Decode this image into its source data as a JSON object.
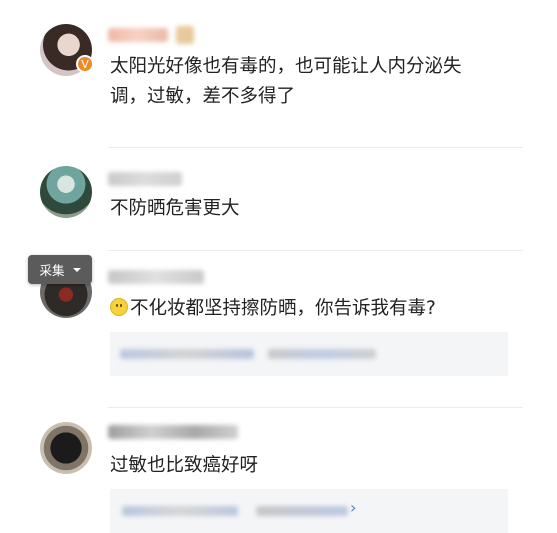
{
  "comments": [
    {
      "text_line1": "太阳光好像也有毒的，也可能让人内分泌失",
      "text_line2": "调，过敏，差不多得了"
    },
    {
      "text": "不防晒危害更大"
    },
    {
      "text": "不化妆都坚持擦防晒，你告诉我有毒?"
    },
    {
      "text": "过敏也比致癌好呀"
    }
  ],
  "overlay": {
    "collect_label": "采集"
  },
  "reply_more_arrow": "›",
  "icons": [
    "vip-badge-icon",
    "smile-emoji-icon",
    "chevron-down-icon",
    "chevron-right-icon"
  ],
  "colors": {
    "badge": "#f08a24",
    "reply_link": "#5a7ebf",
    "reply_bg": "#f4f5f7"
  }
}
